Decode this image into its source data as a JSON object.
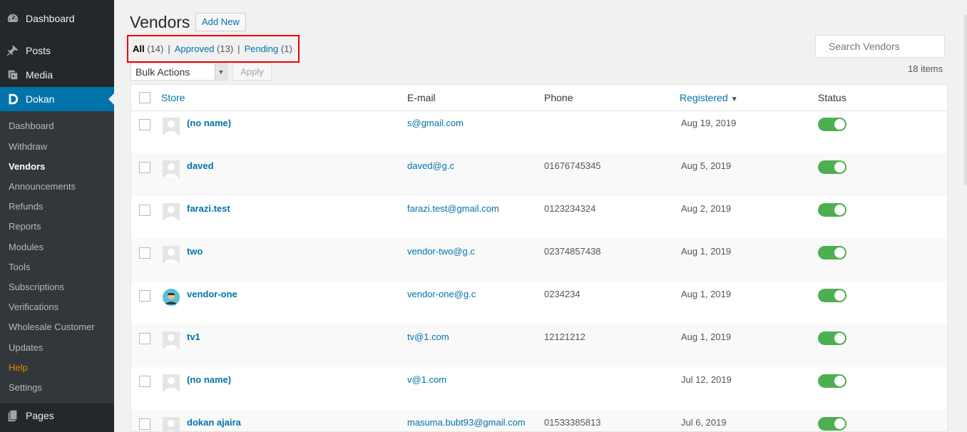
{
  "sidebar": {
    "top_items": [
      {
        "label": "Dashboard",
        "icon": "dashboard-icon"
      },
      {
        "label": "Posts",
        "icon": "pin-icon"
      },
      {
        "label": "Media",
        "icon": "media-icon"
      },
      {
        "label": "Dokan",
        "icon": "dokan-logo-icon"
      },
      {
        "label": "Pages",
        "icon": "pages-icon"
      }
    ],
    "submenu": [
      "Dashboard",
      "Withdraw",
      "Vendors",
      "Announcements",
      "Refunds",
      "Reports",
      "Modules",
      "Tools",
      "Subscriptions",
      "Verifications",
      "Wholesale Customer",
      "Updates",
      "Help",
      "Settings"
    ],
    "current_submenu": "Vendors",
    "accent_color": "#0073aa"
  },
  "header": {
    "title": "Vendors",
    "add_new_label": "Add New"
  },
  "filters": {
    "all_label": "All",
    "all_count": "(14)",
    "approved_label": "Approved",
    "approved_count": "(13)",
    "pending_label": "Pending",
    "pending_count": "(1)",
    "separator": "|"
  },
  "search": {
    "placeholder": "Search Vendors"
  },
  "bulk": {
    "selected": "Bulk Actions",
    "apply_label": "Apply"
  },
  "items_count": "18 items",
  "table": {
    "columns": {
      "store": "Store",
      "email": "E-mail",
      "phone": "Phone",
      "registered": "Registered",
      "status": "Status"
    },
    "rows": [
      {
        "store": "(no name)",
        "email": "s@gmail.com",
        "phone": "",
        "registered": "Aug 19, 2019",
        "enabled": true
      },
      {
        "store": "daved",
        "email": "daved@g.c",
        "phone": "01676745345",
        "registered": "Aug 5, 2019",
        "enabled": true
      },
      {
        "store": "farazi.test",
        "email": "farazi.test@gmail.com",
        "phone": "0123234324",
        "registered": "Aug 2, 2019",
        "enabled": true
      },
      {
        "store": "two",
        "email": "vendor-two@g.c",
        "phone": "02374857438",
        "registered": "Aug 1, 2019",
        "enabled": true
      },
      {
        "store": "vendor-one",
        "email": "vendor-one@g.c",
        "phone": "0234234",
        "registered": "Aug 1, 2019",
        "enabled": true
      },
      {
        "store": "tv1",
        "email": "tv@1.com",
        "phone": "12121212",
        "registered": "Aug 1, 2019",
        "enabled": true
      },
      {
        "store": "(no name)",
        "email": "v@1.com",
        "phone": "",
        "registered": "Jul 12, 2019",
        "enabled": true
      },
      {
        "store": "dokan ajaira",
        "email": "masuma.bubt93@gmail.com",
        "phone": "01533385813",
        "registered": "Jul 6, 2019",
        "enabled": true
      }
    ]
  },
  "colors": {
    "toggle_on": "#4caf50",
    "link": "#0073aa",
    "highlight_box": "#e00000"
  }
}
